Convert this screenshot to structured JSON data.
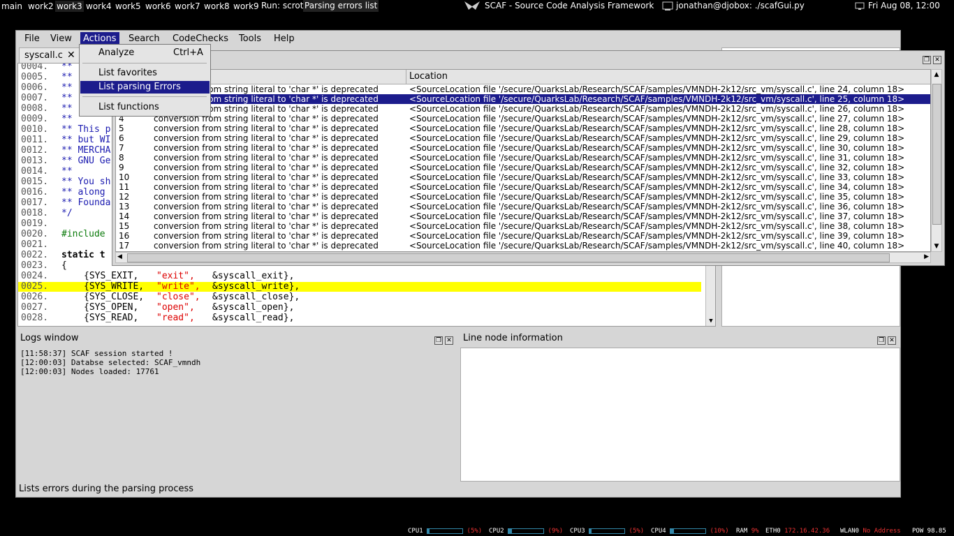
{
  "topbar": {
    "workspaces": [
      "main",
      "work2",
      "work3",
      "work4",
      "work5",
      "work6",
      "work7",
      "work8",
      "work9"
    ],
    "run_label": "Run: scrot",
    "window_title": "Parsing errors list",
    "app_title": "SCAF - Source Code Analysis Framework",
    "terminal": "jonathan@djobox: ./scafGui.py",
    "clock": "Fri Aug 08, 12:00"
  },
  "menubar": [
    "File",
    "View",
    "Actions",
    "Search",
    "CodeChecks",
    "Tools",
    "Help"
  ],
  "actions_menu": {
    "items": [
      {
        "label": "Analyze",
        "shortcut": "Ctrl+A"
      },
      {
        "label": "List favorites",
        "shortcut": ""
      },
      {
        "label": "List parsing Errors",
        "shortcut": ""
      },
      {
        "label": "List functions",
        "shortcut": ""
      }
    ]
  },
  "editor": {
    "tab_label": "syscall.c",
    "lines": [
      {
        "n": "0004.",
        "t": "**"
      },
      {
        "n": "0005.",
        "t": "**"
      },
      {
        "n": "0006.",
        "t": "**"
      },
      {
        "n": "0007.",
        "t": "**"
      },
      {
        "n": "0008.",
        "t": "**"
      },
      {
        "n": "0009.",
        "t": "**"
      },
      {
        "n": "0010.",
        "t": "** This p"
      },
      {
        "n": "0011.",
        "t": "** but WI"
      },
      {
        "n": "0012.",
        "t": "** MERCHA"
      },
      {
        "n": "0013.",
        "t": "** GNU Ge"
      },
      {
        "n": "0014.",
        "t": "**"
      },
      {
        "n": "0015.",
        "t": "** You sh"
      },
      {
        "n": "0016.",
        "t": "** along"
      },
      {
        "n": "0017.",
        "t": "** Founda"
      },
      {
        "n": "0018.",
        "t": "*/"
      },
      {
        "n": "0019.",
        "t": ""
      },
      {
        "n": "0020.",
        "t": "#include"
      },
      {
        "n": "0021.",
        "t": ""
      },
      {
        "n": "0022.",
        "t": "static t"
      },
      {
        "n": "0023.",
        "t": "{"
      }
    ],
    "table_lines": [
      {
        "n": "0024.",
        "a": "{SYS_EXIT,",
        "b": "\"exit\",",
        "c": "&syscall_exit},"
      },
      {
        "n": "0025.",
        "a": "{SYS_WRITE,",
        "b": "\"write\",",
        "c": "&syscall_write},"
      },
      {
        "n": "0026.",
        "a": "{SYS_CLOSE,",
        "b": "\"close\",",
        "c": "&syscall_close},"
      },
      {
        "n": "0027.",
        "a": "{SYS_OPEN,",
        "b": "\"open\",",
        "c": "&syscall_open},"
      },
      {
        "n": "0028.",
        "a": "{SYS_READ,",
        "b": "\"read\",",
        "c": "&syscall_read},"
      }
    ]
  },
  "errors_window": {
    "col_location": "Location",
    "rows": [
      {
        "id": "",
        "msg": "conversion from string literal to 'char *' is deprecated",
        "loc": "<SourceLocation file '/secure/QuarksLab/Research/SCAF/samples/VMNDH-2k12/src_vm/syscall.c', line 24, column 18>"
      },
      {
        "id": "",
        "msg": "conversion from string literal to 'char *' is deprecated",
        "loc": "<SourceLocation file '/secure/QuarksLab/Research/SCAF/samples/VMNDH-2k12/src_vm/syscall.c', line 25, column 18>"
      },
      {
        "id": "",
        "msg": "conversion from string literal to 'char *' is deprecated",
        "loc": "<SourceLocation file '/secure/QuarksLab/Research/SCAF/samples/VMNDH-2k12/src_vm/syscall.c', line 26, column 18>"
      },
      {
        "id": "4",
        "msg": "conversion from string literal to 'char *' is deprecated",
        "loc": "<SourceLocation file '/secure/QuarksLab/Research/SCAF/samples/VMNDH-2k12/src_vm/syscall.c', line 27, column 18>"
      },
      {
        "id": "5",
        "msg": "conversion from string literal to 'char *' is deprecated",
        "loc": "<SourceLocation file '/secure/QuarksLab/Research/SCAF/samples/VMNDH-2k12/src_vm/syscall.c', line 28, column 18>"
      },
      {
        "id": "6",
        "msg": "conversion from string literal to 'char *' is deprecated",
        "loc": "<SourceLocation file '/secure/QuarksLab/Research/SCAF/samples/VMNDH-2k12/src_vm/syscall.c', line 29, column 18>"
      },
      {
        "id": "7",
        "msg": "conversion from string literal to 'char *' is deprecated",
        "loc": "<SourceLocation file '/secure/QuarksLab/Research/SCAF/samples/VMNDH-2k12/src_vm/syscall.c', line 30, column 18>"
      },
      {
        "id": "8",
        "msg": "conversion from string literal to 'char *' is deprecated",
        "loc": "<SourceLocation file '/secure/QuarksLab/Research/SCAF/samples/VMNDH-2k12/src_vm/syscall.c', line 31, column 18>"
      },
      {
        "id": "9",
        "msg": "conversion from string literal to 'char *' is deprecated",
        "loc": "<SourceLocation file '/secure/QuarksLab/Research/SCAF/samples/VMNDH-2k12/src_vm/syscall.c', line 32, column 18>"
      },
      {
        "id": "10",
        "msg": "conversion from string literal to 'char *' is deprecated",
        "loc": "<SourceLocation file '/secure/QuarksLab/Research/SCAF/samples/VMNDH-2k12/src_vm/syscall.c', line 33, column 18>"
      },
      {
        "id": "11",
        "msg": "conversion from string literal to 'char *' is deprecated",
        "loc": "<SourceLocation file '/secure/QuarksLab/Research/SCAF/samples/VMNDH-2k12/src_vm/syscall.c', line 34, column 18>"
      },
      {
        "id": "12",
        "msg": "conversion from string literal to 'char *' is deprecated",
        "loc": "<SourceLocation file '/secure/QuarksLab/Research/SCAF/samples/VMNDH-2k12/src_vm/syscall.c', line 35, column 18>"
      },
      {
        "id": "13",
        "msg": "conversion from string literal to 'char *' is deprecated",
        "loc": "<SourceLocation file '/secure/QuarksLab/Research/SCAF/samples/VMNDH-2k12/src_vm/syscall.c', line 36, column 18>"
      },
      {
        "id": "14",
        "msg": "conversion from string literal to 'char *' is deprecated",
        "loc": "<SourceLocation file '/secure/QuarksLab/Research/SCAF/samples/VMNDH-2k12/src_vm/syscall.c', line 37, column 18>"
      },
      {
        "id": "15",
        "msg": "conversion from string literal to 'char *' is deprecated",
        "loc": "<SourceLocation file '/secure/QuarksLab/Research/SCAF/samples/VMNDH-2k12/src_vm/syscall.c', line 38, column 18>"
      },
      {
        "id": "16",
        "msg": "conversion from string literal to 'char *' is deprecated",
        "loc": "<SourceLocation file '/secure/QuarksLab/Research/SCAF/samples/VMNDH-2k12/src_vm/syscall.c', line 39, column 18>"
      },
      {
        "id": "17",
        "msg": "conversion from string literal to 'char *' is deprecated",
        "loc": "<SourceLocation file '/secure/QuarksLab/Research/SCAF/samples/VMNDH-2k12/src_vm/syscall.c', line 40, column 18>"
      }
    ]
  },
  "logs": {
    "title": "Logs window",
    "lines": [
      "[11:58:37] SCAF session started !",
      "[12:00:03] Databse selected: SCAF_vmndh",
      "[12:00:03] Nodes loaded: 17761"
    ]
  },
  "line_node": {
    "title": "Line node information"
  },
  "statusbar": {
    "text": "Lists errors during the parsing process"
  },
  "sysbar": {
    "cpu": [
      {
        "label": "CPU1",
        "pct": "(5%)",
        "value": 5
      },
      {
        "label": "CPU2",
        "pct": "(9%)",
        "value": 9
      },
      {
        "label": "CPU3",
        "pct": "(5%)",
        "value": 5
      },
      {
        "label": "CPU4",
        "pct": "(10%)",
        "value": 10
      }
    ],
    "ram_label": "RAM",
    "ram_pct": "9%",
    "eth_label": "ETH0",
    "eth_ip": "172.16.42.36",
    "wlan_label": "WLAN0",
    "wlan_status": "No Address",
    "pow_label": "POW 98.85"
  },
  "colors": {
    "selection": "#1c1c8c",
    "highlight_line": "#ffff00"
  }
}
